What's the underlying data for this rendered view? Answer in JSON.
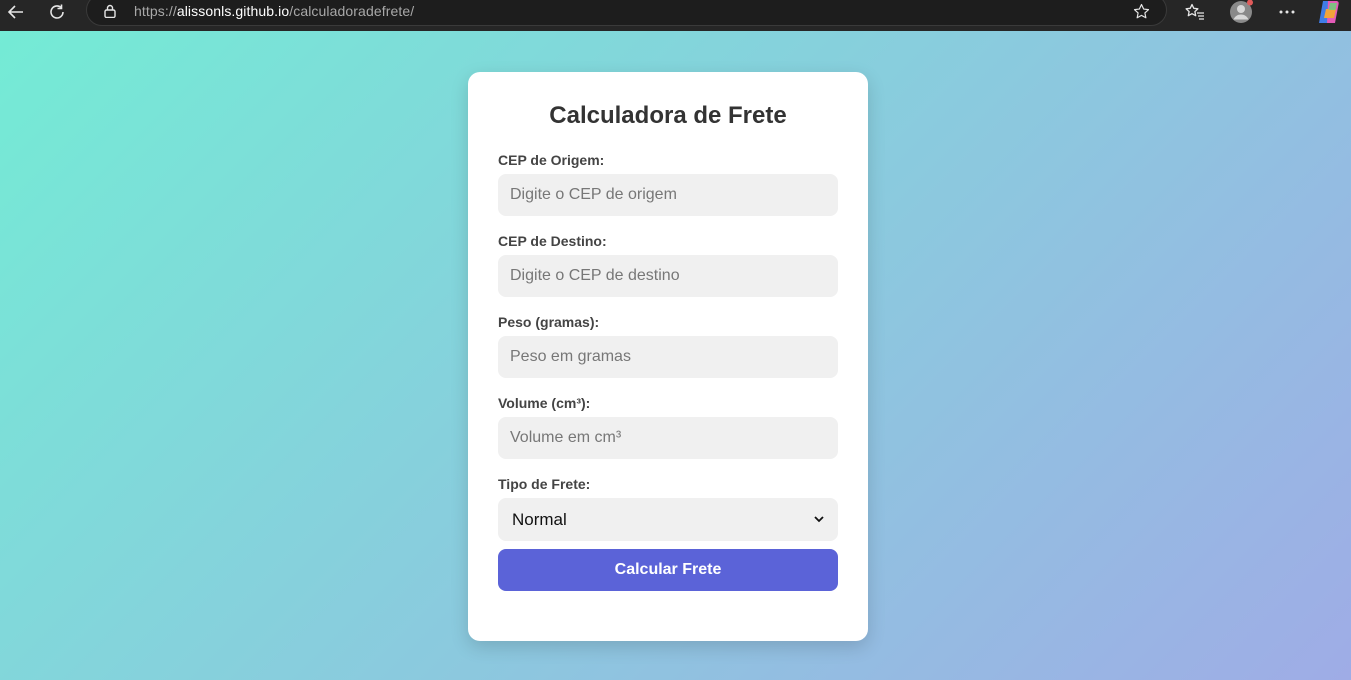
{
  "browser": {
    "url_scheme": "https://",
    "url_host": "alissonls.github.io",
    "url_path": "/calculadoradefrete/"
  },
  "card": {
    "title": "Calculadora de Frete",
    "fields": [
      {
        "label": "CEP de Origem:",
        "placeholder": "Digite o CEP de origem",
        "value": ""
      },
      {
        "label": "CEP de Destino:",
        "placeholder": "Digite o CEP de destino",
        "value": ""
      },
      {
        "label": "Peso (gramas):",
        "placeholder": "Peso em gramas",
        "value": ""
      },
      {
        "label": "Volume (cm³):",
        "placeholder": "Volume em cm³",
        "value": ""
      }
    ],
    "freight_type": {
      "label": "Tipo de Frete:",
      "selected": "Normal"
    },
    "submit_label": "Calcular Frete"
  },
  "colors": {
    "gradient_start": "#74ebd5",
    "gradient_end": "#9face6",
    "button": "#5b63d8",
    "chrome": "#262626"
  }
}
